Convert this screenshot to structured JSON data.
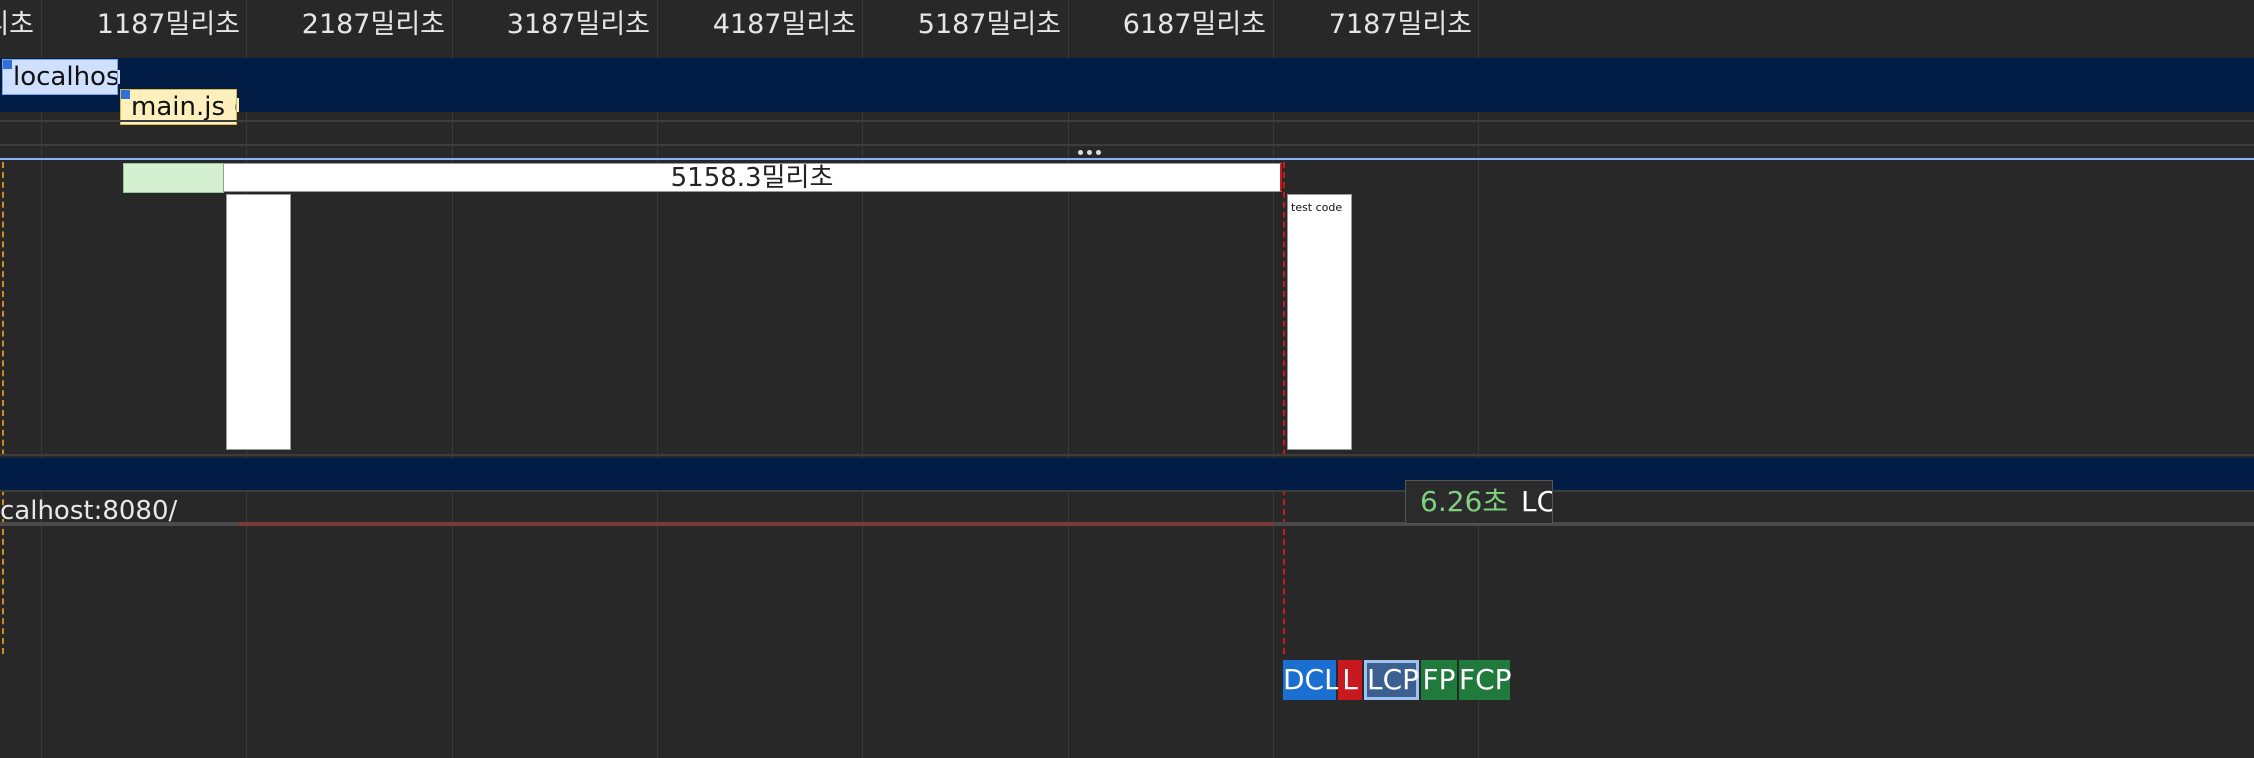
{
  "timeline": {
    "ticks": [
      "리초",
      "1187밀리초",
      "2187밀리초",
      "3187밀리초",
      "4187밀리초",
      "5187밀리초",
      "6187밀리초",
      "7187밀리초"
    ]
  },
  "network": {
    "request_1": "localhost/...",
    "request_2": "main.js (l..."
  },
  "frames": {
    "long_frame_label": "5158.3밀리초",
    "thumbnail_text": "test code"
  },
  "markers": {
    "dcl": "DCL",
    "l": "L",
    "lcp": "LCP",
    "fp": "FP",
    "fcp": "FCP"
  },
  "main_thread": {
    "label": "calhost:8080/"
  },
  "tooltip": {
    "time": "6.26초",
    "label": "LCP"
  },
  "colors": {
    "background": "#282828",
    "band": "#021d45",
    "dcl": "#1a6fd0",
    "l": "#c8191f",
    "lcp": "#3b5f8f",
    "fp": "#1f7a3c",
    "fcp": "#1f7a3c",
    "tooltip_time": "#7fd17f"
  }
}
